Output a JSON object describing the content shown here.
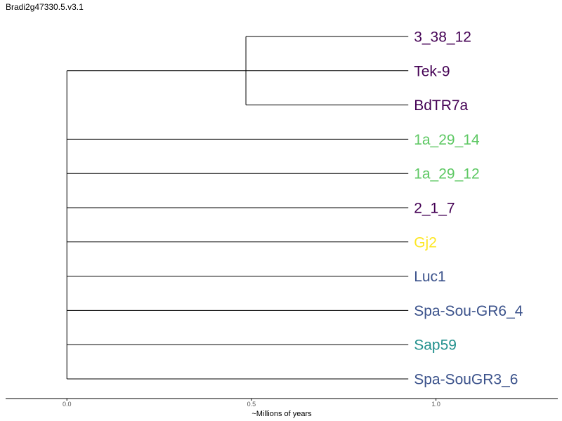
{
  "title": "Bradi2g47330.5.v3.1",
  "chart_data": {
    "type": "dendrogram",
    "xlabel": "~Millions of years",
    "xlim": [
      -0.166,
      1.33
    ],
    "xticks": [
      0.0,
      0.5,
      1.0
    ],
    "xtick_labels": [
      "0.0",
      "0.5",
      "1.0"
    ],
    "leaf_tip_x": 0.925,
    "colors": {
      "purple": "#440154",
      "blue": "#3b528b",
      "teal": "#21908d",
      "green": "#5dc863",
      "yellow": "#fde725"
    },
    "leaves": [
      {
        "name": "3_38_12",
        "color": "#440154"
      },
      {
        "name": "Tek-9",
        "color": "#440154"
      },
      {
        "name": "BdTR7a",
        "color": "#440154"
      },
      {
        "name": "1a_29_14",
        "color": "#5dc863"
      },
      {
        "name": "1a_29_12",
        "color": "#5dc863"
      },
      {
        "name": "2_1_7",
        "color": "#440154"
      },
      {
        "name": "Gj2",
        "color": "#fde725"
      },
      {
        "name": "Luc1",
        "color": "#3b528b"
      },
      {
        "name": "Spa-Sou-GR6_4",
        "color": "#3b528b"
      },
      {
        "name": "Sap59",
        "color": "#21908d"
      },
      {
        "name": "Spa-SouGR3_6",
        "color": "#3b528b"
      }
    ],
    "tree": {
      "height": 0,
      "children": [
        {
          "height": 0.485,
          "children": [
            {
              "leaf": 0
            },
            {
              "leaf": 1
            },
            {
              "leaf": 2
            }
          ]
        },
        {
          "leaf": 3
        },
        {
          "leaf": 4
        },
        {
          "leaf": 5
        },
        {
          "leaf": 6
        },
        {
          "leaf": 7
        },
        {
          "leaf": 8
        },
        {
          "leaf": 9
        },
        {
          "leaf": 10
        }
      ]
    }
  }
}
